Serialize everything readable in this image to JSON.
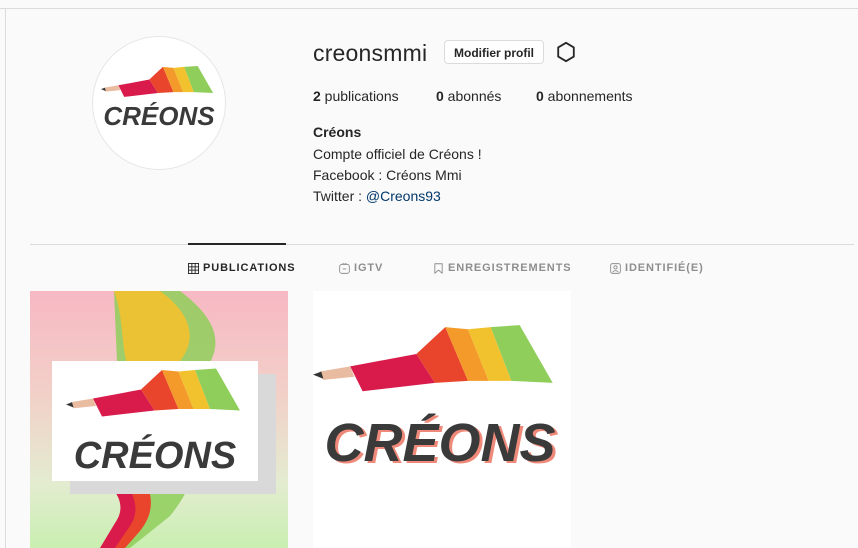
{
  "profile": {
    "username": "creonsmmi",
    "edit_label": "Modifier profil",
    "logo_text": "CRÉONS"
  },
  "stats": {
    "posts_count": "2",
    "posts_label": " publications",
    "followers_count": "0",
    "followers_label": " abonnés",
    "following_count": "0",
    "following_label": " abonnements"
  },
  "bio": {
    "name": "Créons",
    "line1": "Compte officiel de Créons !",
    "line2": "Facebook : Créons Mmi",
    "line3_prefix": "Twitter : ",
    "line3_link": "@Creons93"
  },
  "tabs": [
    {
      "label": "PUBLICATIONS",
      "icon": "grid-icon",
      "active": true
    },
    {
      "label": "IGTV",
      "icon": "igtv-icon",
      "active": false
    },
    {
      "label": "ENREGISTREMENTS",
      "icon": "bookmark-icon",
      "active": false
    },
    {
      "label": "IDENTIFIÉ(E)",
      "icon": "tagged-icon",
      "active": false
    }
  ],
  "colors": {
    "accent_text": "#262626",
    "muted_text": "#8e8e8e",
    "link": "#00376b",
    "border": "#dbdbdb"
  }
}
